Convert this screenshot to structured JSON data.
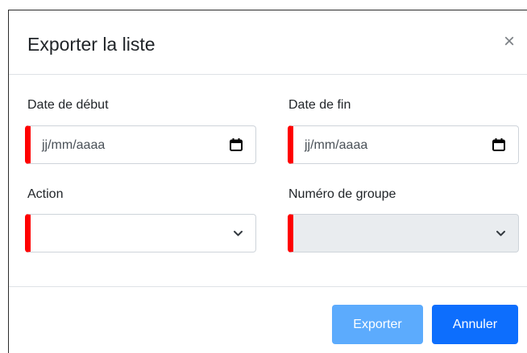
{
  "modal": {
    "title": "Exporter la liste",
    "close_symbol": "×"
  },
  "form": {
    "start_date": {
      "label": "Date de début",
      "placeholder": "jj/mm/aaaa",
      "icon": "calendar-icon"
    },
    "end_date": {
      "label": "Date de fin",
      "placeholder": "jj/mm/aaaa",
      "icon": "calendar-icon"
    },
    "action": {
      "label": "Action",
      "value": "",
      "icon": "chevron-down-icon"
    },
    "group_number": {
      "label": "Numéro de groupe",
      "value": "",
      "icon": "chevron-down-icon",
      "disabled": true
    }
  },
  "footer": {
    "export_label": "Exporter",
    "cancel_label": "Annuler"
  },
  "colors": {
    "required_marker": "#ff0000",
    "export_button": "#5cabfd",
    "cancel_button": "#0d6efd",
    "disabled_field": "#e9ecef"
  }
}
